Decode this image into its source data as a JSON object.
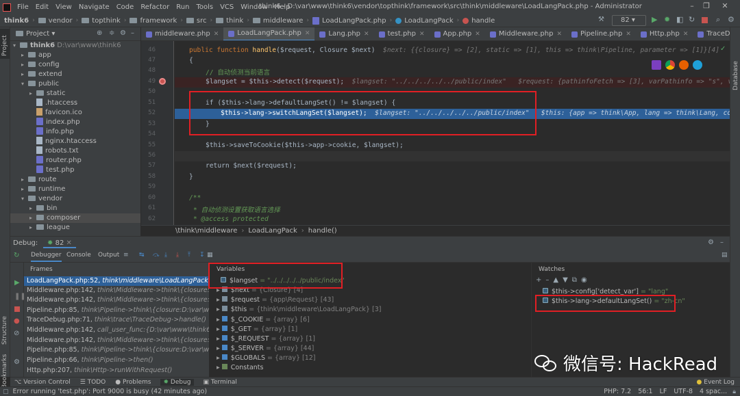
{
  "menu": [
    "File",
    "Edit",
    "View",
    "Navigate",
    "Code",
    "Refactor",
    "Run",
    "Tools",
    "VCS",
    "Window",
    "Help"
  ],
  "window_title": "think6 - D:\\var\\www\\think6\\vendor\\topthink\\framework\\src\\think\\middleware\\LoadLangPack.php - Administrator",
  "navbar": [
    "think6",
    "vendor",
    "topthink",
    "framework",
    "src",
    "think",
    "middleware",
    "LoadLangPack.php",
    "LoadLangPack",
    "handle"
  ],
  "run_config": "82",
  "project": {
    "label": "Project",
    "root_label": "think6",
    "root_path": "D:\\var\\www\\think6",
    "items": [
      "app",
      "config",
      "extend",
      "public",
      "static",
      ".htaccess",
      "favicon.ico",
      "index.php",
      "info.php",
      "nginx.htaccess",
      "robots.txt",
      "router.php",
      "test.php",
      "route",
      "runtime",
      "vendor",
      "bin",
      "composer",
      "league"
    ]
  },
  "tabs": [
    "middleware.php",
    "LoadLangPack.php",
    "Lang.php",
    "test.php",
    "App.php",
    "Middleware.php",
    "Pipeline.php",
    "Http.php",
    "TraceDebug.php",
    "In"
  ],
  "code": {
    "line_numbers": [
      "46",
      "47",
      "48",
      "49",
      "50",
      "51",
      "52",
      "53",
      "54",
      "55",
      "56",
      "57",
      "58",
      "59",
      "60",
      "61",
      "62"
    ],
    "l46_a": "public function ",
    "l46_b": "handle",
    "l46_c": "($request, Closure $next)",
    "l46_hint": "$next: {{closure} => [2], static => [1], this => think\\Pipeline, parameter => [1]}[4]",
    "l47": "{",
    "l48": "// 自动侦测当前语言",
    "l49_code": "$langset = $this->detect($request);",
    "l49_hint": "$langset: \"../../../../../public/index\"   $request: {pathinfoFetch => [3], varPathinfo => \"s\", var",
    "l51": "if ($this->lang->defaultLangSet() != $langset) {",
    "l52_code": "$this->lang->switchLangSet($langset);",
    "l52_hint": "$langset: \"../../../../../public/index\"   $this: {app => think\\App, lang => think\\Lang, co",
    "l53": "}",
    "l55": "$this->saveToCookie($this->app->cookie, $langset);",
    "l57": "return $next($request);",
    "l58": "}",
    "l60": "/**",
    "l61": "* 自动侦测设置获取语言选择",
    "l62": "* @access protected"
  },
  "editor_breadcrumb": [
    "\\think\\middleware",
    "LoadLangPack",
    "handle()"
  ],
  "debug": {
    "label": "Debug:",
    "session": "82",
    "tabs": [
      "Debugger",
      "Console",
      "Output"
    ],
    "frames_title": "Frames",
    "frames": [
      {
        "file": "LoadLangPack.php:52,",
        "ctx": "think\\middleware\\LoadLangPack->han"
      },
      {
        "file": "Middleware.php:142,",
        "ctx": "think\\Middleware->think\\{closure:D:\\va"
      },
      {
        "file": "Middleware.php:142,",
        "ctx": "think\\Middleware->think\\{closure:D:\\va"
      },
      {
        "file": "Pipeline.php:85,",
        "ctx": "think\\Pipeline->think\\{closure:D:\\var\\ww"
      },
      {
        "file": "TraceDebug.php:71,",
        "ctx": "think\\trace\\TraceDebug->handle()"
      },
      {
        "file": "Middleware.php:142,",
        "ctx": "call_user_func:{D:\\var\\www\\think6"
      },
      {
        "file": "Middleware.php:142,",
        "ctx": "think\\Middleware->think\\{closure:D:\\va"
      },
      {
        "file": "Pipeline.php:85,",
        "ctx": "think\\Pipeline->think\\{closure:D:\\var\\ww"
      },
      {
        "file": "Pipeline.php:66,",
        "ctx": "think\\Pipeline->then()"
      },
      {
        "file": "Http.php:207,",
        "ctx": "think\\Http->runWithRequest()"
      }
    ],
    "variables_title": "Variables",
    "variables": [
      {
        "name": "$langset",
        "value": "= \"../../../../../public/index\""
      },
      {
        "name": "$next",
        "value": "= {Closure} [4]"
      },
      {
        "name": "$request",
        "value": "= {app\\Request} [43]"
      },
      {
        "name": "$this",
        "value": "= {think\\middleware\\LoadLangPack} [3]"
      },
      {
        "name": "$_COOKIE",
        "value": "= {array} [6]"
      },
      {
        "name": "$_GET",
        "value": "= {array} [1]"
      },
      {
        "name": "$_REQUEST",
        "value": "= {array} [1]"
      },
      {
        "name": "$_SERVER",
        "value": "= {array} [44]"
      },
      {
        "name": "$GLOBALS",
        "value": "= {array} [12]"
      },
      {
        "name": "Constants",
        "value": ""
      }
    ],
    "watches_title": "Watches",
    "watches": [
      {
        "expr": "$this->config['detect_var']",
        "value": "= \"lang\""
      },
      {
        "expr": "$this->lang->defaultLangSet()",
        "value": "= \"zh-cn\""
      }
    ]
  },
  "bottom_tools": [
    "Version Control",
    "TODO",
    "Problems",
    "Debug",
    "Terminal"
  ],
  "event_log": "Event Log",
  "status": {
    "message": "Error running 'test.php': Port 9000 is busy (42 minutes ago)",
    "php": "PHP: 7.2",
    "pos": "56:1",
    "lf": "LF",
    "enc": "UTF-8",
    "indent": "4 spac..."
  },
  "watermark": "微信号: HackRead",
  "stripes": {
    "left": [
      "Project",
      "Structure",
      "Bookmarks"
    ],
    "right": [
      "Database"
    ]
  }
}
